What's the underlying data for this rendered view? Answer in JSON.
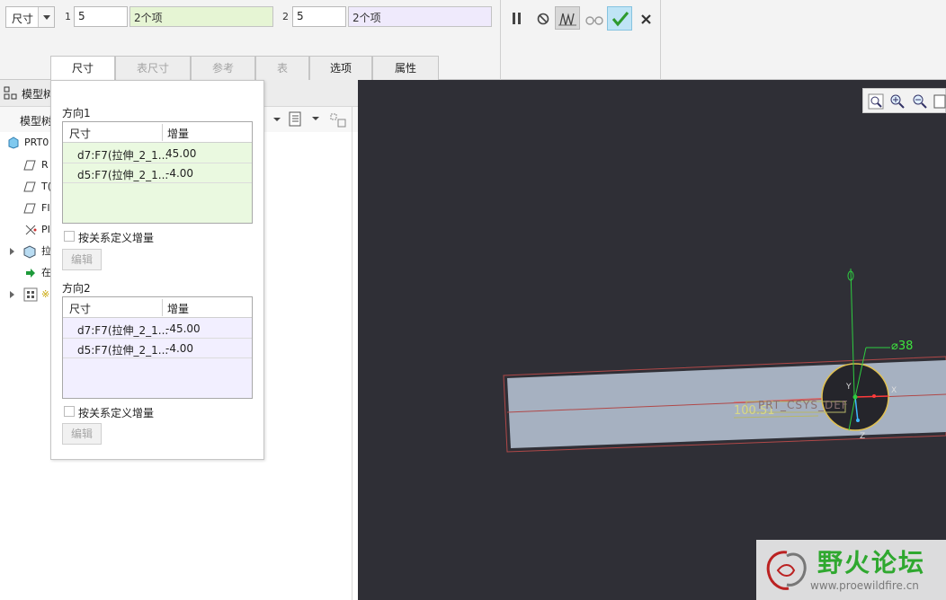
{
  "dashboard": {
    "dim_select": "尺寸",
    "dir1": {
      "number": "1",
      "value": "5",
      "collector": "2个项"
    },
    "dir2": {
      "number": "2",
      "value": "5",
      "collector": "2个项"
    },
    "tabs": [
      {
        "label": "尺寸",
        "state": "active"
      },
      {
        "label": "表尺寸",
        "state": "disabled"
      },
      {
        "label": "参考",
        "state": "disabled"
      },
      {
        "label": "表",
        "state": "disabled"
      },
      {
        "label": "选项",
        "state": "normal"
      },
      {
        "label": "属性",
        "state": "normal"
      }
    ],
    "tools": [
      "pause-icon",
      "no-preview-icon",
      "verify-mode-icon",
      "glasses-preview-icon",
      "confirm-check-icon",
      "cancel-x-icon"
    ],
    "colors": {
      "dir1_collector": "#e6f5d4",
      "dir2_collector": "#efeafc",
      "confirm": "#2e9a2e"
    }
  },
  "tree": {
    "header": "模型树",
    "sub": "模型树",
    "rows": [
      {
        "label": "PRT0",
        "icon": "part-icon"
      },
      {
        "label": "R",
        "icon": "datum-plane-icon"
      },
      {
        "label": "T(",
        "icon": "datum-plane-icon"
      },
      {
        "label": "FI",
        "icon": "datum-plane-icon"
      },
      {
        "label": "PI",
        "icon": "csys-icon"
      },
      {
        "label": "拉",
        "icon": "extrude-icon"
      },
      {
        "label": "在",
        "icon": "insert-here-icon"
      },
      {
        "label": "※",
        "icon": "pattern-icon"
      }
    ]
  },
  "panel": {
    "dir1_title": "方向1",
    "dir2_title": "方向2",
    "col_dim": "尺寸",
    "col_inc": "增量",
    "dir1_rows": [
      {
        "dim": "d7:F7(拉伸_2_1...",
        "inc": "45.00"
      },
      {
        "dim": "d5:F7(拉伸_2_1...",
        "inc": "-4.00"
      }
    ],
    "dir2_rows": [
      {
        "dim": "d7:F7(拉伸_2_1...",
        "inc": "-45.00"
      },
      {
        "dim": "d5:F7(拉伸_2_1...",
        "inc": "-4.00"
      }
    ],
    "checkbox_label": "按关系定义增量",
    "edit_label": "编辑"
  },
  "graphics": {
    "diameter_label": "⌀38",
    "length_label": "100.51",
    "csys_label": "PRT_CSYS_DEF",
    "axis_labels": [
      "Y",
      "X",
      "Z"
    ],
    "tools": [
      "refit-icon",
      "zoom-in-icon",
      "zoom-out-icon",
      "repaint-icon"
    ]
  },
  "watermark": {
    "title": "野火论坛",
    "url": "www.proewildfire.cn"
  }
}
